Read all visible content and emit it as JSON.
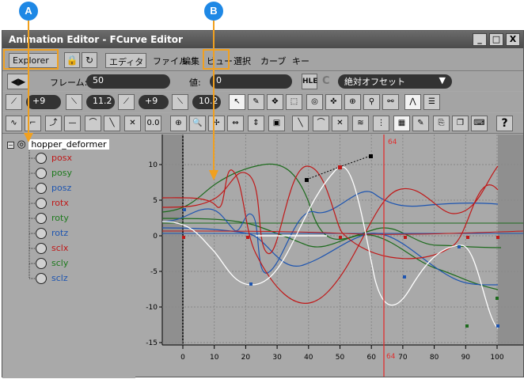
{
  "callouts": {
    "a": "A",
    "b": "B"
  },
  "window": {
    "title": "Animation Editor - FCurve Editor",
    "min": "_",
    "max": "□",
    "close": "X"
  },
  "menu": {
    "explorer": "Explorer",
    "editor": "エディタ",
    "items": [
      "ファイル",
      "編集",
      "ビュー",
      "選択",
      "カーブ",
      "キー"
    ]
  },
  "frame": {
    "label": "フレーム:",
    "value": "50",
    "value_label": "値:",
    "value_value": "0",
    "mode": "絶対オフセット"
  },
  "tangents": {
    "t1": "+9",
    "t2": "11.2",
    "t3": "+9",
    "t4": "10.2"
  },
  "tree": {
    "root": "hopper_deformer",
    "items": [
      {
        "label": "posx",
        "color": "#c01818"
      },
      {
        "label": "posy",
        "color": "#1d7a1d"
      },
      {
        "label": "posz",
        "color": "#1e55b0"
      },
      {
        "label": "rotx",
        "color": "#c01818"
      },
      {
        "label": "roty",
        "color": "#1d7a1d"
      },
      {
        "label": "rotz",
        "color": "#1e55b0"
      },
      {
        "label": "sclx",
        "color": "#c01818"
      },
      {
        "label": "scly",
        "color": "#1d7a1d"
      },
      {
        "label": "sclz",
        "color": "#1e55b0"
      }
    ]
  },
  "graph": {
    "current_frame": "64",
    "y_ticks": [
      "10",
      "5",
      "0",
      "-5",
      "-10",
      "-15"
    ],
    "x_ticks": [
      "0",
      "10",
      "20",
      "30",
      "40",
      "50",
      "60",
      "70",
      "80",
      "90",
      "100"
    ]
  },
  "colors": {
    "accent": "#1e88e5",
    "highlight": "#f0a020",
    "time_cursor": "#e03030"
  }
}
